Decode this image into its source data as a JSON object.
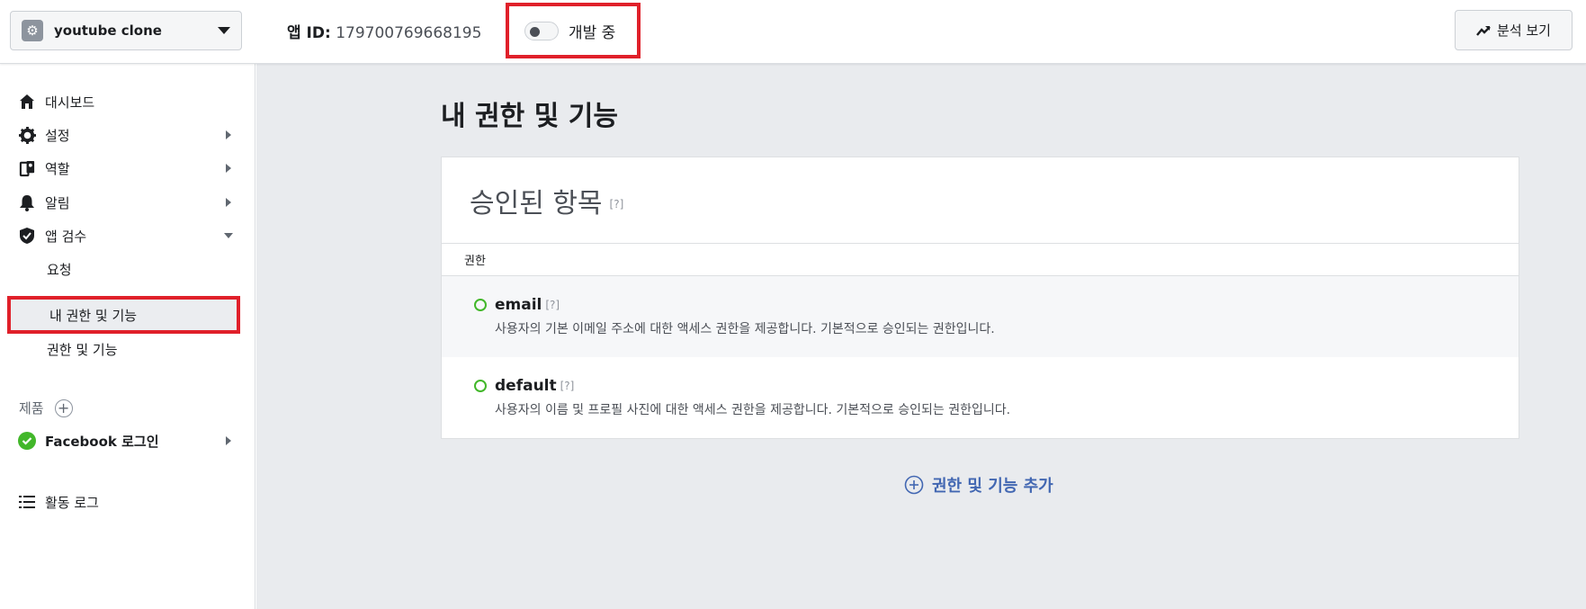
{
  "topbar": {
    "app_name": "youtube clone",
    "app_id_label": "앱 ID:",
    "app_id_value": "179700769668195",
    "dev_status": "개발 중",
    "analytics_label": "분석 보기"
  },
  "sidebar": {
    "items": [
      {
        "label": "대시보드",
        "icon": "home-icon"
      },
      {
        "label": "설정",
        "icon": "gear-icon"
      },
      {
        "label": "역할",
        "icon": "roles-icon"
      },
      {
        "label": "알림",
        "icon": "bell-icon"
      },
      {
        "label": "앱 검수",
        "icon": "shield-check-icon"
      }
    ],
    "sub_items": [
      {
        "label": "요청"
      },
      {
        "label": "내 권한 및 기능"
      },
      {
        "label": "권한 및 기능"
      }
    ],
    "products_label": "제품",
    "facebook_login": "Facebook 로그인",
    "activity_log": "활동 로그"
  },
  "main": {
    "page_title": "내 권한 및 기능",
    "card_title": "승인된 항목",
    "qmark": "[?]",
    "column_header": "권한",
    "permissions": [
      {
        "name": "email",
        "qmark": "[?]",
        "desc": "사용자의 기본 이메일 주소에 대한 액세스 권한을 제공합니다. 기본적으로 승인되는 권한입니다."
      },
      {
        "name": "default",
        "qmark": "[?]",
        "desc": "사용자의 이름 및 프로필 사진에 대한 액세스 권한을 제공합니다. 기본적으로 승인되는 권한입니다."
      }
    ],
    "add_link": "권한 및 기능 추가"
  },
  "colors": {
    "accent_blue": "#4267b2",
    "highlight_red": "#e0202a",
    "status_green": "#42b72a"
  }
}
